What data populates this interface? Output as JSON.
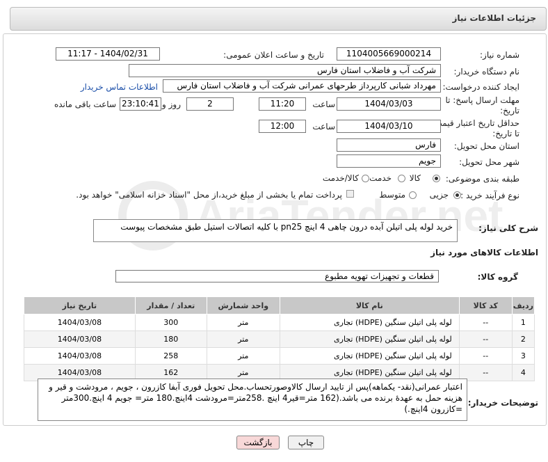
{
  "header": {
    "title": "جزئیات اطلاعات نیاز"
  },
  "labels": {
    "need_number": "شماره نیاز:",
    "announce_datetime": "تاریخ و ساعت اعلان عمومی:",
    "buyer_org": "نام دستگاه خریدار:",
    "request_creator": "ایجاد کننده درخواست:",
    "reply_deadline_1": "مهلت ارسال پاسخ: تا",
    "reply_deadline_2": "تاریخ:",
    "hour": "ساعت",
    "day": "روز و",
    "remaining": "ساعت باقی مانده",
    "price_validity_1": "حداقل تاریخ اعتبار قیمت:",
    "price_validity_2": "تا تاریخ:",
    "delivery_province": "استان محل تحویل:",
    "delivery_city": "شهر محل تحویل:",
    "category": "طبقه بندی موضوعی:",
    "purchase_type": "نوع فرآیند خرید :",
    "overall_desc": "شرح کلی نیاز:",
    "goods_info": "اطلاعات کالاهای مورد نیاز",
    "goods_group": "گروه کالا:",
    "buyer_notes": "توضیحات خریدار:"
  },
  "fields": {
    "need_number": "1104005669000214",
    "announce_datetime": "1404/02/31 - 11:17",
    "buyer_org": "شرکت آب و فاضلاب استان فارس",
    "request_creator": "مهرداد شبانی کارپرداز طرحهای عمرانی  شرکت آب و فاضلاب استان فارس",
    "contact_link": "اطلاعات تماس خریدار",
    "reply_date": "1404/03/03",
    "reply_hour": "11:20",
    "reply_days": "2",
    "reply_remaining": "23:10:41",
    "validity_date": "1404/03/10",
    "validity_hour": "12:00",
    "province": "فارس",
    "city": "جویم",
    "overall_desc": "خرید لوله پلی اتیلن آبده درون چاهی 4 اینچ pn25 با کلیه اتصالات استیل  طبق مشخصات  پیوست",
    "goods_group": "قطعات و تجهیزات تهویه مطبوع",
    "buyer_notes": "اعتبار عمرانی(نقد- یکماهه)پس از تایید ارسال کالاوصورتحساب.محل تحویل فوری آبفا کازرون ، جویم ، مرودشت و قیر  و هزینه حمل  به عهدهٔ برنده می باشد.(162 متر=قیر4 اینچ .258متر=مرودشت 4اینچ.180 متر= جویم 4 اینچ.300متر =کازرون 4اینچ.)"
  },
  "category_options": [
    "کالا",
    "خدمت",
    "کالا/خدمت"
  ],
  "category_selected": "کالا",
  "purchase_options": [
    "جزیی",
    "متوسط"
  ],
  "purchase_selected": "جزیی",
  "payment_note": "پرداخت تمام یا بخشی از مبلغ خرید،از محل \"اسناد خزانه اسلامی\" خواهد بود.",
  "table": {
    "headers": [
      "ردیف",
      "کد کالا",
      "نام کالا",
      "واحد شمارش",
      "تعداد / مقدار",
      "تاریخ نیاز"
    ],
    "rows": [
      [
        "1",
        "--",
        "لوله پلی اتیلن سنگین (HDPE) تجاری",
        "متر",
        "300",
        "1404/03/08"
      ],
      [
        "2",
        "--",
        "لوله پلی اتیلن سنگین (HDPE) تجاری",
        "متر",
        "180",
        "1404/03/08"
      ],
      [
        "3",
        "--",
        "لوله پلی اتیلن سنگین (HDPE) تجاری",
        "متر",
        "258",
        "1404/03/08"
      ],
      [
        "4",
        "--",
        "لوله پلی اتیلن سنگین (HDPE) تجاری",
        "متر",
        "162",
        "1404/03/08"
      ]
    ]
  },
  "buttons": {
    "print": "چاپ",
    "back": "بازگشت"
  },
  "watermark": {
    "text": "AriaTender.net"
  },
  "colors": {
    "back_button_bg": "#f8d8d8",
    "header_bg": "#dcdcdc",
    "table_header_bg": "#c8c8c8",
    "link": "#1a4ea8"
  }
}
